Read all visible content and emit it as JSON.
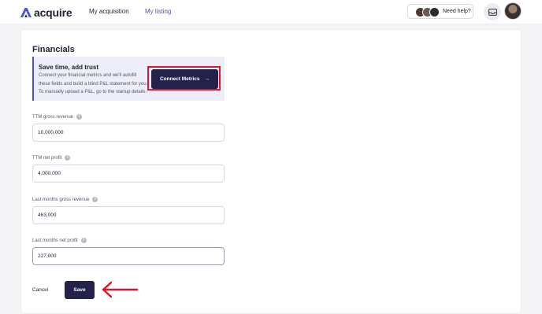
{
  "header": {
    "logo_text": "acquire",
    "nav": [
      {
        "label": "My acquisition",
        "active": false
      },
      {
        "label": "My listing",
        "active": true
      }
    ],
    "help_label": "Need help?",
    "help_avatar_colors": [
      "#4b3a34",
      "#6f5a52",
      "#2e2a2a"
    ]
  },
  "financials": {
    "title": "Financials",
    "trust_title": "Save time, add trust",
    "trust_text": "Connect your financial metrics and we'll autofill these fields and build a blind P&L statement for you. To manually upload a P&L, go to the startup details.",
    "connect_label": "Connect Metrics",
    "connect_arrow": "→",
    "fields": [
      {
        "label": "TTM gross revenue",
        "value": "10,000,000"
      },
      {
        "label": "TTM net profit",
        "value": "4,000,000"
      },
      {
        "label": "Last months gross revenue",
        "value": "463,000"
      },
      {
        "label": "Last months net profit",
        "value": "227,000"
      }
    ],
    "info_glyph": "i",
    "cancel_label": "Cancel",
    "save_label": "Save"
  },
  "colors": {
    "accent": "#4a54d8",
    "primary_button": "#22224a",
    "annotation": "#e0142a"
  }
}
